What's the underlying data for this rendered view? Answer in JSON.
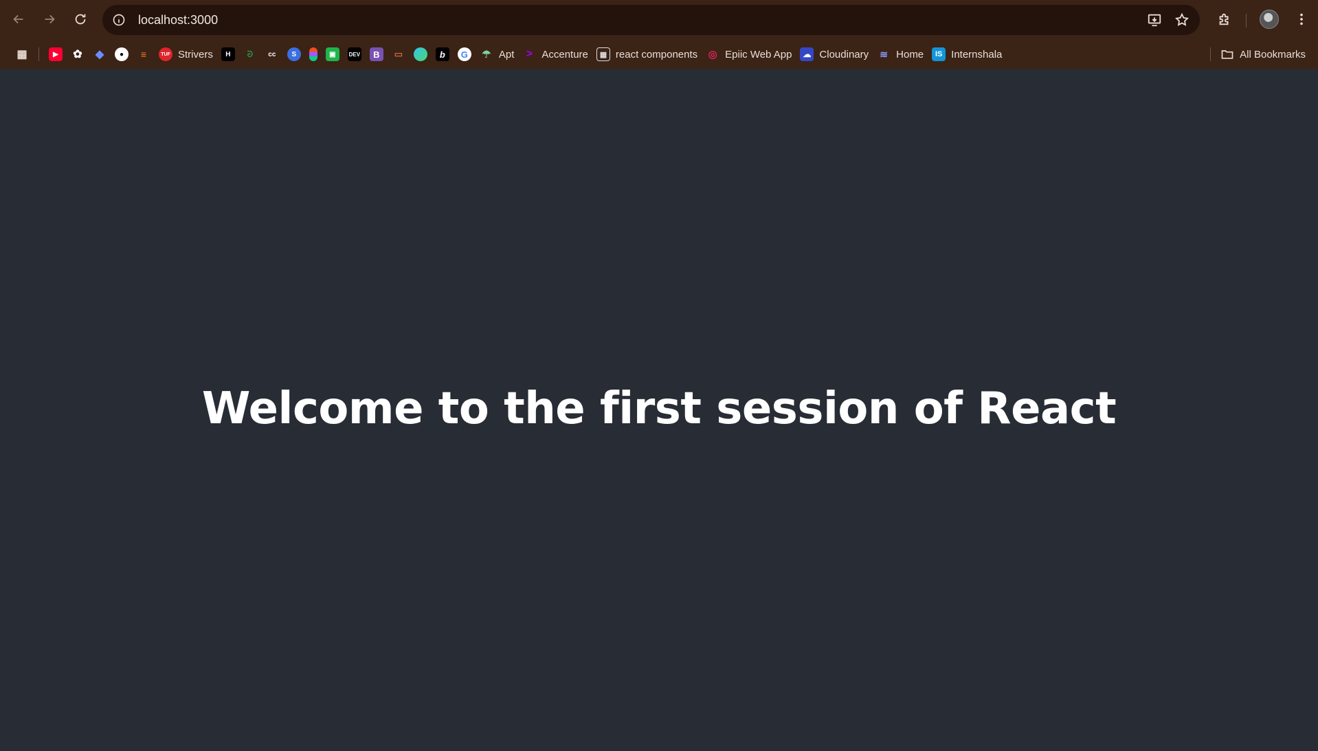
{
  "browser": {
    "url": "localhost:3000",
    "colors": {
      "frame": "#3b2316",
      "omnibox": "#24130c",
      "page_bg": "#282c34"
    }
  },
  "bookmarks": {
    "items": [
      {
        "label": "",
        "icon": "apps-grid-icon"
      },
      {
        "label": "",
        "icon": "youtube-icon"
      },
      {
        "label": "",
        "icon": "chatgpt-icon"
      },
      {
        "label": "",
        "icon": "deepseek-icon"
      },
      {
        "label": "",
        "icon": "github-icon"
      },
      {
        "label": "",
        "icon": "stack-icon"
      },
      {
        "label": "Strivers",
        "icon": "tuf-icon"
      },
      {
        "label": "",
        "icon": "hackerearth-icon"
      },
      {
        "label": "",
        "icon": "geeksforgeeks-icon"
      },
      {
        "label": "",
        "icon": "codechef-icon"
      },
      {
        "label": "",
        "icon": "s-icon"
      },
      {
        "label": "",
        "icon": "figma-icon"
      },
      {
        "label": "",
        "icon": "green-app-icon"
      },
      {
        "label": "",
        "icon": "dev-icon"
      },
      {
        "label": "",
        "icon": "bootstrap-icon"
      },
      {
        "label": "",
        "icon": "image-icon"
      },
      {
        "label": "",
        "icon": "edge-icon"
      },
      {
        "label": "",
        "icon": "b-icon"
      },
      {
        "label": "",
        "icon": "google-icon"
      },
      {
        "label": "Apt",
        "icon": "apt-icon"
      },
      {
        "label": "Accenture",
        "icon": "accenture-icon"
      },
      {
        "label": "react components",
        "icon": "components-icon"
      },
      {
        "label": "Epiic Web App",
        "icon": "epiic-icon"
      },
      {
        "label": "Cloudinary",
        "icon": "cloudinary-icon"
      },
      {
        "label": "Home",
        "icon": "home-wave-icon"
      },
      {
        "label": "Internshala",
        "icon": "internshala-icon"
      }
    ],
    "all_bookmarks_label": "All Bookmarks"
  },
  "page": {
    "heading": "Welcome to the first session of React"
  }
}
